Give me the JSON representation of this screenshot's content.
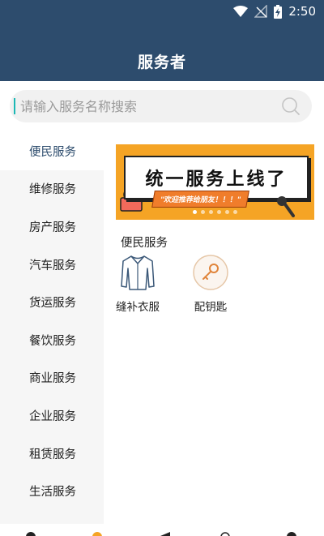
{
  "status_bar": {
    "time": "2:50"
  },
  "header": {
    "title": "服务者"
  },
  "search": {
    "placeholder": "请输入服务名称搜索"
  },
  "sidebar": {
    "items": [
      {
        "label": "便民服务"
      },
      {
        "label": "维修服务"
      },
      {
        "label": "房产服务"
      },
      {
        "label": "汽车服务"
      },
      {
        "label": "货运服务"
      },
      {
        "label": "餐饮服务"
      },
      {
        "label": "商业服务"
      },
      {
        "label": "企业服务"
      },
      {
        "label": "租赁服务"
      },
      {
        "label": "生活服务"
      }
    ]
  },
  "banner": {
    "headline": "统一服务上线了",
    "subline": "\"欢迎推荐给朋友！！！\""
  },
  "section": {
    "title": "便民服务"
  },
  "services": [
    {
      "label": "缝补衣服",
      "icon": "shirt-icon"
    },
    {
      "label": "配钥匙",
      "icon": "key-icon"
    }
  ],
  "colors": {
    "header": "#2d4c6d",
    "accent": "#f5a425",
    "active_text": "#2d4c6d",
    "sidebar_bg": "#f6f6f6"
  }
}
